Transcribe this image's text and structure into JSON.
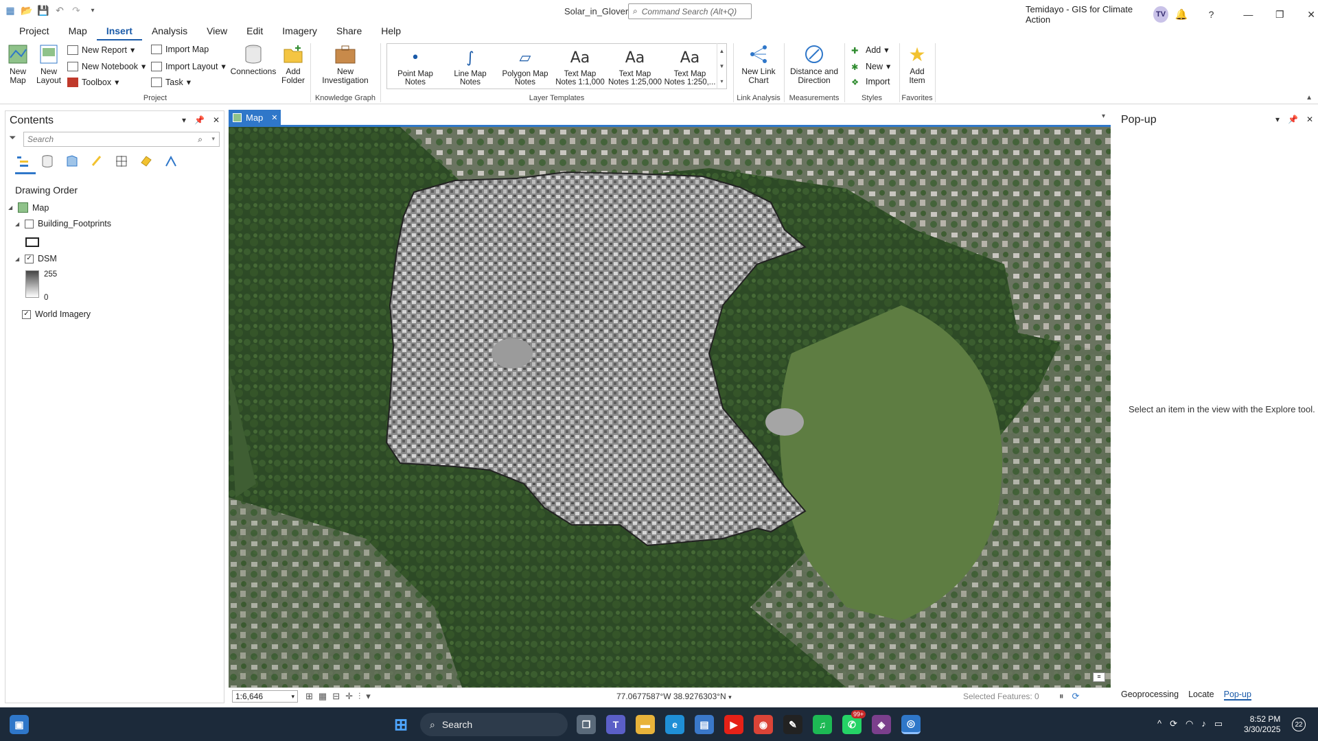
{
  "window": {
    "title": "Solar_in_Glover",
    "user": "Temidayo - GIS for Climate Action",
    "avatar": "TV"
  },
  "command_search": {
    "placeholder": "Command Search (Alt+Q)"
  },
  "menu": [
    "Project",
    "Map",
    "Insert",
    "Analysis",
    "View",
    "Edit",
    "Imagery",
    "Share",
    "Help"
  ],
  "menu_active": "Insert",
  "ribbon": {
    "project": {
      "label": "Project",
      "new_map": "New Map",
      "new_layout": "New Layout",
      "new_report": "New Report",
      "new_notebook": "New Notebook",
      "toolbox": "Toolbox",
      "import_map": "Import Map",
      "import_layout": "Import Layout",
      "task": "Task",
      "connections": "Connections",
      "add_folder": "Add Folder"
    },
    "knowledge_graph": {
      "label": "Knowledge Graph",
      "new_investigation": "New Investigation"
    },
    "layer_templates": {
      "label": "Layer Templates",
      "items": [
        "Point Map Notes",
        "Line Map Notes",
        "Polygon Map Notes",
        "Text Map Notes 1:1,000",
        "Text Map Notes 1:25,000",
        "Text Map Notes 1:250,..."
      ]
    },
    "link_analysis": {
      "label": "Link Analysis",
      "new_link_chart": "New Link Chart"
    },
    "measurements": {
      "label": "Measurements",
      "distance_direction": "Distance and Direction"
    },
    "styles": {
      "label": "Styles",
      "add": "Add",
      "new": "New",
      "import": "Import"
    },
    "favorites": {
      "label": "Favorites",
      "add_item": "Add Item"
    }
  },
  "contents": {
    "title": "Contents",
    "search_placeholder": "Search",
    "drawing_order": "Drawing Order",
    "map_name": "Map",
    "layers": [
      {
        "name": "Building_Footprints",
        "checked": false
      },
      {
        "name": "DSM",
        "checked": true,
        "max": "255",
        "min": "0"
      },
      {
        "name": "World Imagery",
        "checked": true
      }
    ]
  },
  "map_tab": "Map",
  "status": {
    "scale": "1:6,646",
    "coords": "77.0677587°W 38.9276303°N",
    "selected": "Selected Features: 0"
  },
  "popup": {
    "title": "Pop-up",
    "message": "Select an item in the view with the Explore tool."
  },
  "bottom_tabs": [
    "Geoprocessing",
    "Locate",
    "Pop-up"
  ],
  "taskbar": {
    "search": "Search",
    "time": "8:52 PM",
    "date": "3/30/2025",
    "badge_whatsapp": "99+",
    "notif": "22"
  },
  "colors": {
    "accent": "#2f77c9",
    "taskbar": "#1c2a3a",
    "forest": "#2d4a26"
  }
}
